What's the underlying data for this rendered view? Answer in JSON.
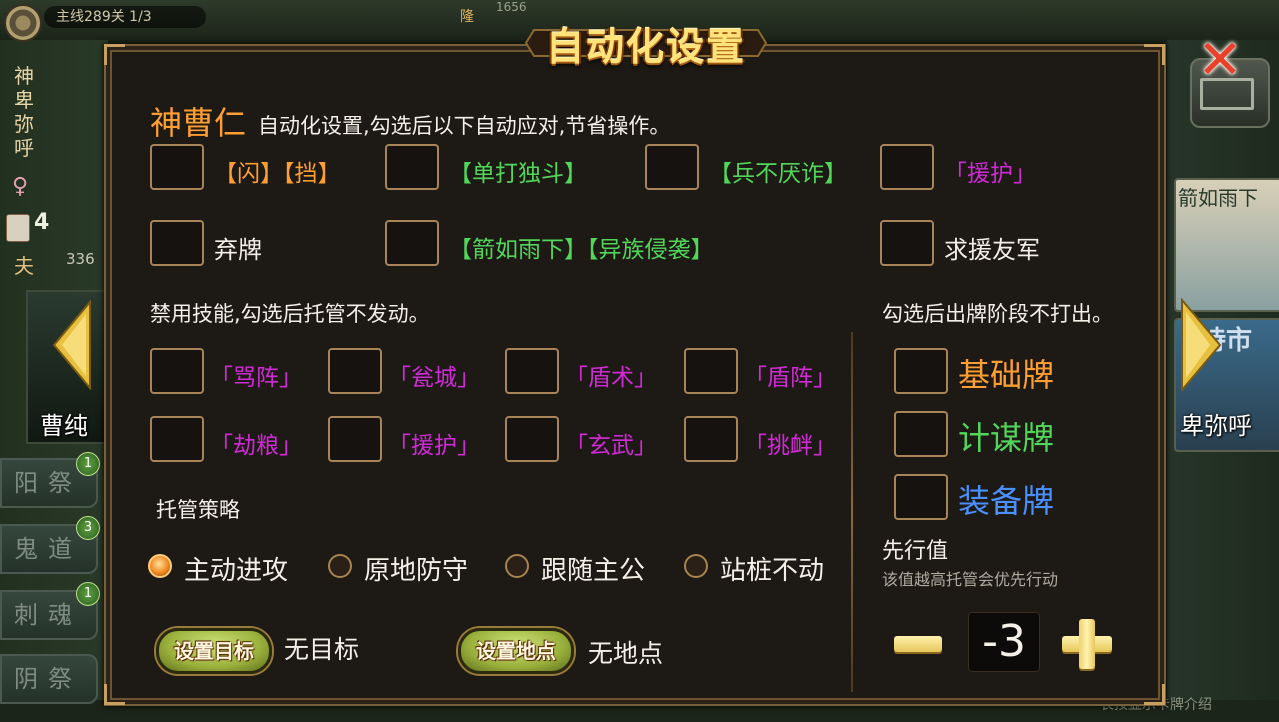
{
  "background": {
    "stage_label": "主线289关 1/3",
    "top_number": "1656",
    "top_tag": "隆",
    "left_hero": {
      "name_vertical": "神卑弥呼",
      "gender_symbol": "♀",
      "card_count": "4",
      "role": "夫",
      "hp": "336",
      "adjacent_name": "曹纯"
    },
    "right_hero": {
      "card_title_1": "箭如雨下",
      "card_title_2": "诗市",
      "adjacent_name": "卑弥呼"
    },
    "side_buttons": [
      {
        "label": "阳祭",
        "badge": "1"
      },
      {
        "label": "鬼道",
        "badge": "3"
      },
      {
        "label": "刺魂",
        "badge": "1"
      },
      {
        "label": "阴祭",
        "badge": ""
      }
    ],
    "bottom_hint": "长按显示卡牌介绍"
  },
  "dialog": {
    "title": "自动化设置",
    "close_icon": "close-x-icon",
    "hero_name": "神曹仁",
    "intro": "自动化设置,勾选后以下自动应对,节省操作。",
    "auto_row1": {
      "a": "【闪】【挡】",
      "b": "【单打独斗】",
      "c": "【兵不厌诈】",
      "d": "「援护」"
    },
    "auto_row2": {
      "a": "弃牌",
      "b": "【箭如雨下】【异族侵袭】",
      "c": "求援友军"
    },
    "disable_heading": "禁用技能,勾选后托管不发动。",
    "disable_skills": [
      "「骂阵」",
      "「瓮城」",
      "「盾术」",
      "「盾阵」",
      "「劫粮」",
      "「援护」",
      "「玄武」",
      "「挑衅」"
    ],
    "strategy_heading": "托管策略",
    "strategies": [
      "主动进攻",
      "原地防守",
      "跟随主公",
      "站桩不动"
    ],
    "selected_strategy": "主动进攻",
    "target_button": "设置目标",
    "target_value": "无目标",
    "location_button": "设置地点",
    "location_value": "无地点",
    "card_heading": "勾选后出牌阶段不打出。",
    "card_types": [
      "基础牌",
      "计谋牌",
      "装备牌"
    ],
    "priority_label": "先行值",
    "priority_hint": "该值越高托管会优先行动",
    "priority_value": "-3"
  },
  "colors": {
    "orange": "#ff9e32",
    "green": "#52d65a",
    "purple": "#d02ad6",
    "blue": "#4a90ff",
    "gold": "#ffe27a"
  }
}
